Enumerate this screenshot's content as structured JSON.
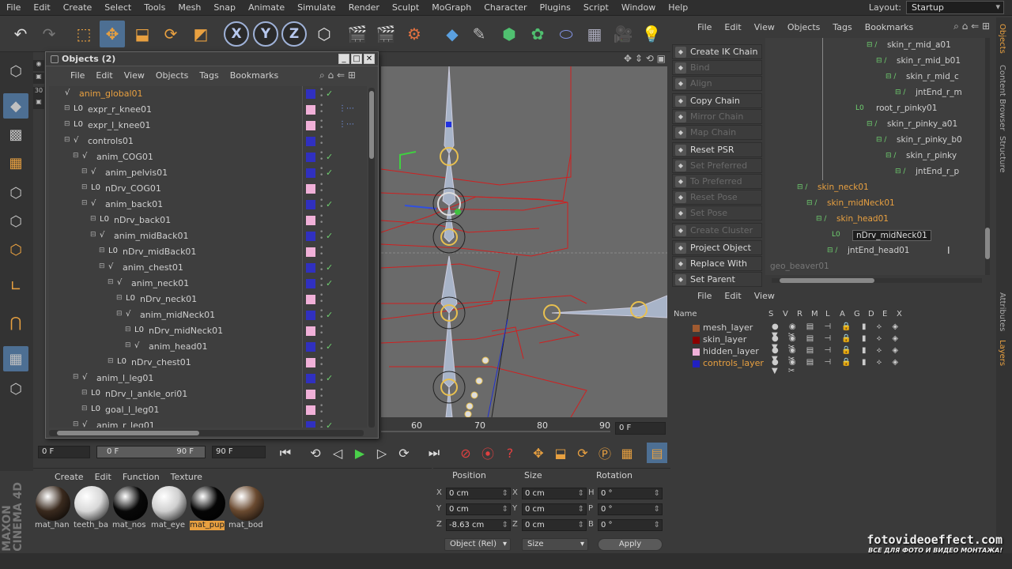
{
  "menubar": {
    "items": [
      "File",
      "Edit",
      "Create",
      "Select",
      "Tools",
      "Mesh",
      "Snap",
      "Animate",
      "Simulate",
      "Render",
      "Sculpt",
      "MoGraph",
      "Character",
      "Plugins",
      "Script",
      "Window",
      "Help"
    ],
    "layout_label": "Layout:",
    "layout_value": "Startup"
  },
  "objects_window": {
    "title": "Objects (2)",
    "menu": [
      "File",
      "Edit",
      "View",
      "Objects",
      "Tags",
      "Bookmarks"
    ],
    "rows": [
      {
        "name": "anim_global01",
        "indent": 0,
        "color": "#3030c0",
        "selected": true,
        "check": true
      },
      {
        "name": "expr_r_knee01",
        "indent": 1,
        "color": "#f0b0d8",
        "check": false
      },
      {
        "name": "expr_l_knee01",
        "indent": 1,
        "color": "#f0b0d8",
        "check": false
      },
      {
        "name": "controls01",
        "indent": 1,
        "color": "#3030c0",
        "check": false
      },
      {
        "name": "anim_COG01",
        "indent": 2,
        "color": "#3030c0",
        "check": true
      },
      {
        "name": "anim_pelvis01",
        "indent": 3,
        "color": "#3030c0",
        "check": true
      },
      {
        "name": "nDrv_COG01",
        "indent": 3,
        "color": "#f0b0d8",
        "check": false
      },
      {
        "name": "anim_back01",
        "indent": 3,
        "color": "#3030c0",
        "check": true
      },
      {
        "name": "nDrv_back01",
        "indent": 4,
        "color": "#f0b0d8",
        "check": false
      },
      {
        "name": "anim_midBack01",
        "indent": 4,
        "color": "#3030c0",
        "check": true
      },
      {
        "name": "nDrv_midBack01",
        "indent": 5,
        "color": "#f0b0d8",
        "check": false
      },
      {
        "name": "anim_chest01",
        "indent": 5,
        "color": "#3030c0",
        "check": true
      },
      {
        "name": "anim_neck01",
        "indent": 6,
        "color": "#3030c0",
        "check": true
      },
      {
        "name": "nDrv_neck01",
        "indent": 7,
        "color": "#f0b0d8",
        "check": false
      },
      {
        "name": "anim_midNeck01",
        "indent": 7,
        "color": "#3030c0",
        "check": true
      },
      {
        "name": "nDrv_midNeck01",
        "indent": 8,
        "color": "#f0b0d8",
        "check": false
      },
      {
        "name": "anim_head01",
        "indent": 8,
        "color": "#3030c0",
        "check": true
      },
      {
        "name": "nDrv_chest01",
        "indent": 6,
        "color": "#f0b0d8",
        "check": false
      },
      {
        "name": "anim_l_leg01",
        "indent": 2,
        "color": "#3030c0",
        "check": true
      },
      {
        "name": "nDrv_l_ankle_ori01",
        "indent": 3,
        "color": "#f0b0d8",
        "check": false
      },
      {
        "name": "goal_l_leg01",
        "indent": 3,
        "color": "#f0b0d8",
        "check": false
      },
      {
        "name": "anim_r_leg01",
        "indent": 2,
        "color": "#3030c0",
        "check": true
      }
    ]
  },
  "timeline": {
    "ticks": [
      "60",
      "70",
      "80",
      "90"
    ],
    "frame_field": "0 F"
  },
  "transport": {
    "start": "0 F",
    "range_start": "0 F",
    "range_end": "90 F",
    "end": "90 F"
  },
  "materials": {
    "menu": [
      "Create",
      "Edit",
      "Function",
      "Texture"
    ],
    "items": [
      {
        "label": "mat_han",
        "color": "#3a2a1e",
        "active": false
      },
      {
        "label": "teeth_ba",
        "color": "#d8d8d8",
        "active": false
      },
      {
        "label": "mat_nos",
        "color": "#080808",
        "active": false
      },
      {
        "label": "mat_eye",
        "color": "#cfcfcf",
        "active": false
      },
      {
        "label": "mat_pup",
        "color": "#050505",
        "active": true
      },
      {
        "label": "mat_bod",
        "color": "#6a4a30",
        "active": false
      }
    ]
  },
  "coords": {
    "headers": [
      "Position",
      "Size",
      "Rotation"
    ],
    "rows": [
      {
        "a": "X",
        "pos": "0 cm",
        "b": "X",
        "size": "0 cm",
        "c": "H",
        "rot": "0 °"
      },
      {
        "a": "Y",
        "pos": "0 cm",
        "b": "Y",
        "size": "0 cm",
        "c": "P",
        "rot": "0 °"
      },
      {
        "a": "Z",
        "pos": "-8.63 cm",
        "b": "Z",
        "size": "0 cm",
        "c": "B",
        "rot": "0 °"
      }
    ],
    "mode": "Object (Rel)",
    "size_mode": "Size",
    "apply": "Apply"
  },
  "right_objects": {
    "menu": [
      "File",
      "Edit",
      "View",
      "Objects",
      "Tags",
      "Bookmarks"
    ],
    "commands": [
      {
        "label": "Create IK Chain",
        "enabled": true
      },
      {
        "label": "Bind",
        "enabled": false
      },
      {
        "label": "Align",
        "enabled": false
      },
      {
        "label": "Copy Chain",
        "enabled": true
      },
      {
        "label": "Mirror Chain",
        "enabled": false
      },
      {
        "label": "Map Chain",
        "enabled": false
      },
      {
        "label": "Reset PSR",
        "enabled": true
      },
      {
        "label": "Set Preferred",
        "enabled": false
      },
      {
        "label": "To Preferred",
        "enabled": false
      },
      {
        "label": "Reset Pose",
        "enabled": false
      },
      {
        "label": "Set Pose",
        "enabled": false
      },
      {
        "label": "Create Cluster",
        "enabled": false
      },
      {
        "label": "Project Object",
        "enabled": true
      },
      {
        "label": "Replace With",
        "enabled": true
      },
      {
        "label": "Set Parent",
        "enabled": true
      }
    ],
    "tree": [
      {
        "name": "skin_r_mid_a01",
        "style": "n"
      },
      {
        "name": "skin_r_mid_b01",
        "style": "n"
      },
      {
        "name": "skin_r_mid_c",
        "style": "n"
      },
      {
        "name": "jntEnd_r_m",
        "style": "n"
      },
      {
        "name": "root_r_pinky01",
        "style": "n"
      },
      {
        "name": "skin_r_pinky_a01",
        "style": "n"
      },
      {
        "name": "skin_r_pinky_b0",
        "style": "n"
      },
      {
        "name": "skin_r_pinky",
        "style": "n"
      },
      {
        "name": "jntEnd_r_p",
        "style": "n"
      },
      {
        "name": "skin_neck01",
        "style": "or"
      },
      {
        "name": "skin_midNeck01",
        "style": "or"
      },
      {
        "name": "skin_head01",
        "style": "or"
      },
      {
        "name": "nDrv_midNeck01",
        "style": "edit"
      },
      {
        "name": "jntEnd_head01",
        "style": "n"
      },
      {
        "name": "geo_beaver01",
        "style": "gr"
      }
    ]
  },
  "layers": {
    "menu": [
      "File",
      "Edit",
      "View"
    ],
    "header": "Name",
    "header_cols": [
      "S",
      "V",
      "R",
      "M",
      "L",
      "A",
      "G",
      "D",
      "E",
      "X"
    ],
    "rows": [
      {
        "name": "mesh_layer",
        "color": "#a05a30",
        "orange": false
      },
      {
        "name": "skin_layer",
        "color": "#8a0000",
        "orange": false
      },
      {
        "name": "hidden_layer",
        "color": "#f0b0d8",
        "orange": false
      },
      {
        "name": "controls_layer",
        "color": "#2020c0",
        "orange": true
      }
    ]
  },
  "side_tabs": [
    "Objects",
    "Content Browser",
    "Structure",
    "Attributes",
    "Layers"
  ],
  "branding": {
    "logo": "MAXON CINEMA 4D",
    "watermark": "fotovideoeffect.com",
    "watermark_sub": "ВСЕ ДЛЯ ФОТО И ВИДЕО МОНТАЖА!"
  }
}
